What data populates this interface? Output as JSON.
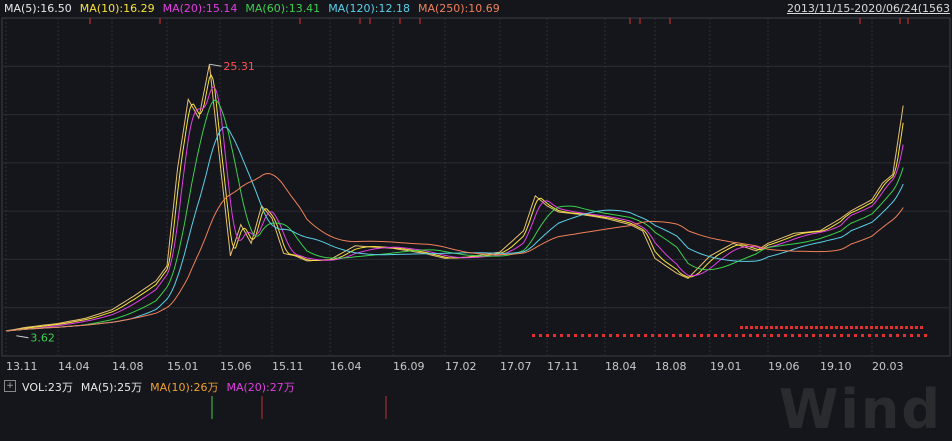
{
  "ma_legend": [
    {
      "text": "MA(5):16.50",
      "color": "#e8e8e8"
    },
    {
      "text": "MA(10):16.29",
      "color": "#f5e23b"
    },
    {
      "text": "MA(20):15.14",
      "color": "#e040e0"
    },
    {
      "text": "MA(60):13.41",
      "color": "#3ccf4e"
    },
    {
      "text": "MA(120):12.18",
      "color": "#5ad0e8"
    },
    {
      "text": "MA(250):10.69",
      "color": "#f0805a"
    }
  ],
  "date_range": "2013/11/15-2020/06/24(1563",
  "vol_legend": [
    {
      "text": "VOL:23万",
      "color": "#e8e8e8"
    },
    {
      "text": "MA(5):25万",
      "color": "#e8e8e8"
    },
    {
      "text": "MA(10):26万",
      "color": "#f0a030"
    },
    {
      "text": "MA(20):27万",
      "color": "#e040e0"
    }
  ],
  "vol_box_label": "+",
  "watermark": "Wind",
  "chart_data": {
    "type": "line",
    "x_labels": [
      "13.11",
      "14.04",
      "14.08",
      "15.01",
      "15.06",
      "15.11",
      "16.04",
      "16.09",
      "17.02",
      "17.07",
      "17.11",
      "18.04",
      "18.08",
      "19.01",
      "19.06",
      "19.10",
      "20.03"
    ],
    "annotations": [
      {
        "label": "25.31",
        "x": "15.05",
        "y": 25.31,
        "color": "#ff5050"
      },
      {
        "label": "3.62",
        "x": "13.12",
        "y": 3.62,
        "color": "#3ccf4e"
      }
    ],
    "price_series": {
      "x": [
        "13.11",
        "14.01",
        "14.04",
        "14.06",
        "14.08",
        "14.10",
        "14.12",
        "15.01",
        "15.02",
        "15.03",
        "15.04",
        "15.05",
        "15.06",
        "15.07",
        "15.08",
        "15.09",
        "15.10",
        "15.11",
        "15.12",
        "16.01",
        "16.02",
        "16.04",
        "16.06",
        "16.09",
        "16.12",
        "17.02",
        "17.04",
        "17.07",
        "17.09",
        "17.10",
        "17.11",
        "17.12",
        "18.02",
        "18.04",
        "18.06",
        "18.07",
        "18.08",
        "18.10",
        "18.11",
        "19.01",
        "19.03",
        "19.05",
        "19.06",
        "19.08",
        "19.10",
        "19.12",
        "20.01",
        "20.03",
        "20.04",
        "20.05",
        "20.06"
      ],
      "y": [
        4.0,
        4.3,
        4.6,
        5.0,
        5.7,
        6.8,
        8.0,
        9.2,
        17.0,
        22.5,
        21.0,
        25.3,
        17.5,
        10.0,
        12.5,
        11.0,
        14.0,
        13.0,
        10.2,
        10.0,
        9.6,
        9.7,
        10.8,
        10.6,
        10.2,
        9.8,
        9.9,
        10.3,
        12.0,
        14.8,
        14.0,
        13.5,
        13.3,
        13.0,
        12.5,
        12.0,
        9.8,
        8.6,
        8.2,
        10.0,
        11.0,
        10.4,
        11.0,
        11.8,
        12.0,
        13.0,
        13.6,
        14.5,
        15.8,
        16.5,
        22.0
      ]
    },
    "ylim": [
      2,
      29
    ],
    "grid": true
  }
}
